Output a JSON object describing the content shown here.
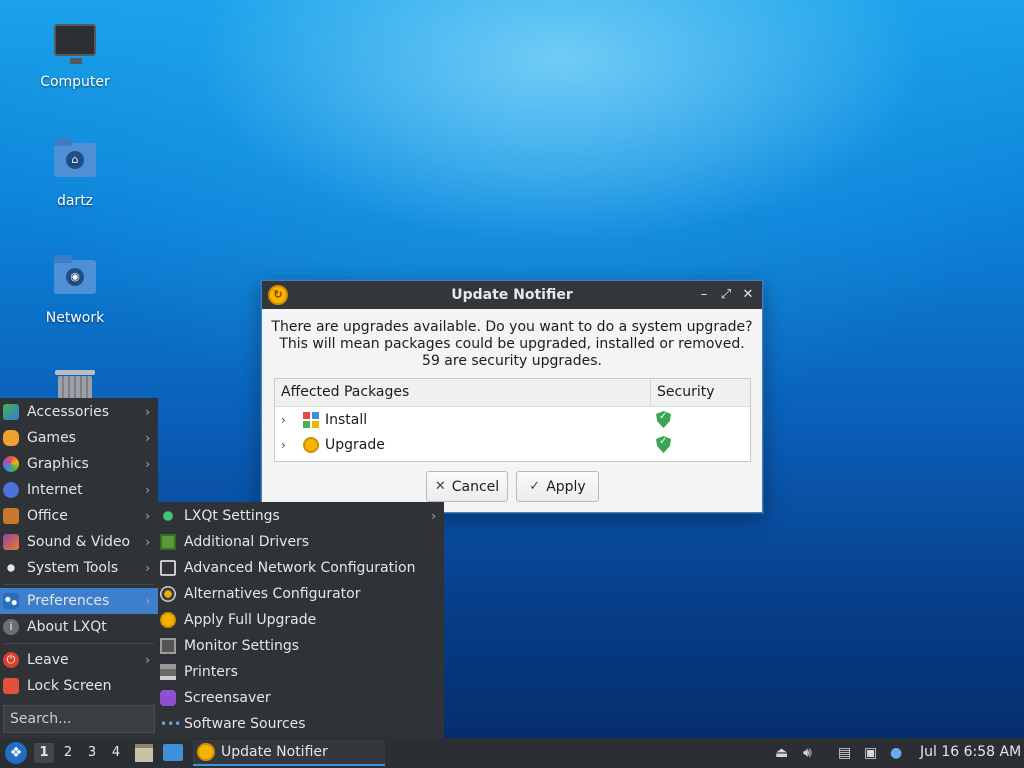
{
  "desktop": {
    "icons": [
      {
        "label": "Computer",
        "icon": "computer-icon"
      },
      {
        "label": "dartz",
        "icon": "home-folder-icon"
      },
      {
        "label": "Network",
        "icon": "network-folder-icon"
      },
      {
        "label": "",
        "icon": "trash-icon"
      }
    ]
  },
  "dialog": {
    "title": "Update Notifier",
    "message_line1": "There are upgrades available. Do you want to do a system upgrade?",
    "message_line2": "This will mean packages could be upgraded, installed or removed.",
    "message_line3": "59 are security upgrades.",
    "table": {
      "columns": [
        "Affected Packages",
        "Security"
      ],
      "rows": [
        {
          "label": "Install",
          "security": "shield-check"
        },
        {
          "label": "Upgrade",
          "security": "shield-check"
        }
      ]
    },
    "cancel_label": "Cancel",
    "apply_label": "Apply",
    "window_buttons": {
      "minimize": "–",
      "maximize": "⤢",
      "close": "✕"
    }
  },
  "start_menu": {
    "items": [
      {
        "label": "Accessories",
        "icon": "accessories-icon",
        "submenu": true
      },
      {
        "label": "Games",
        "icon": "games-icon",
        "submenu": true
      },
      {
        "label": "Graphics",
        "icon": "graphics-icon",
        "submenu": true
      },
      {
        "label": "Internet",
        "icon": "internet-icon",
        "submenu": true
      },
      {
        "label": "Office",
        "icon": "office-icon",
        "submenu": true
      },
      {
        "label": "Sound & Video",
        "icon": "sound-video-icon",
        "submenu": true
      },
      {
        "label": "System Tools",
        "icon": "system-tools-icon",
        "submenu": true
      },
      {
        "label": "Preferences",
        "icon": "preferences-icon",
        "submenu": true,
        "active": true
      },
      {
        "label": "About LXQt",
        "icon": "info-icon",
        "submenu": false
      },
      {
        "label": "Leave",
        "icon": "power-icon",
        "submenu": true
      },
      {
        "label": "Lock Screen",
        "icon": "lock-icon",
        "submenu": false
      }
    ],
    "search_placeholder": "Search..."
  },
  "preferences_submenu": {
    "items": [
      {
        "label": "LXQt Settings",
        "icon": "lxqt-settings-icon",
        "submenu": true
      },
      {
        "label": "Additional Drivers",
        "icon": "chip-icon",
        "submenu": false
      },
      {
        "label": "Advanced Network Configuration",
        "icon": "network-monitor-icon",
        "submenu": false
      },
      {
        "label": "Alternatives Configurator",
        "icon": "alternatives-icon",
        "submenu": false
      },
      {
        "label": "Apply Full Upgrade",
        "icon": "upgrade-icon",
        "submenu": false
      },
      {
        "label": "Monitor Settings",
        "icon": "monitor-icon",
        "submenu": false
      },
      {
        "label": "Printers",
        "icon": "printer-icon",
        "submenu": false
      },
      {
        "label": "Screensaver",
        "icon": "screensaver-icon",
        "submenu": false
      },
      {
        "label": "Software Sources",
        "icon": "software-sources-icon",
        "submenu": false
      }
    ]
  },
  "taskbar": {
    "workspaces": [
      "1",
      "2",
      "3",
      "4"
    ],
    "active_workspace": "1",
    "task_label": "Update Notifier",
    "clock": "Jul 16 6:58 AM"
  }
}
